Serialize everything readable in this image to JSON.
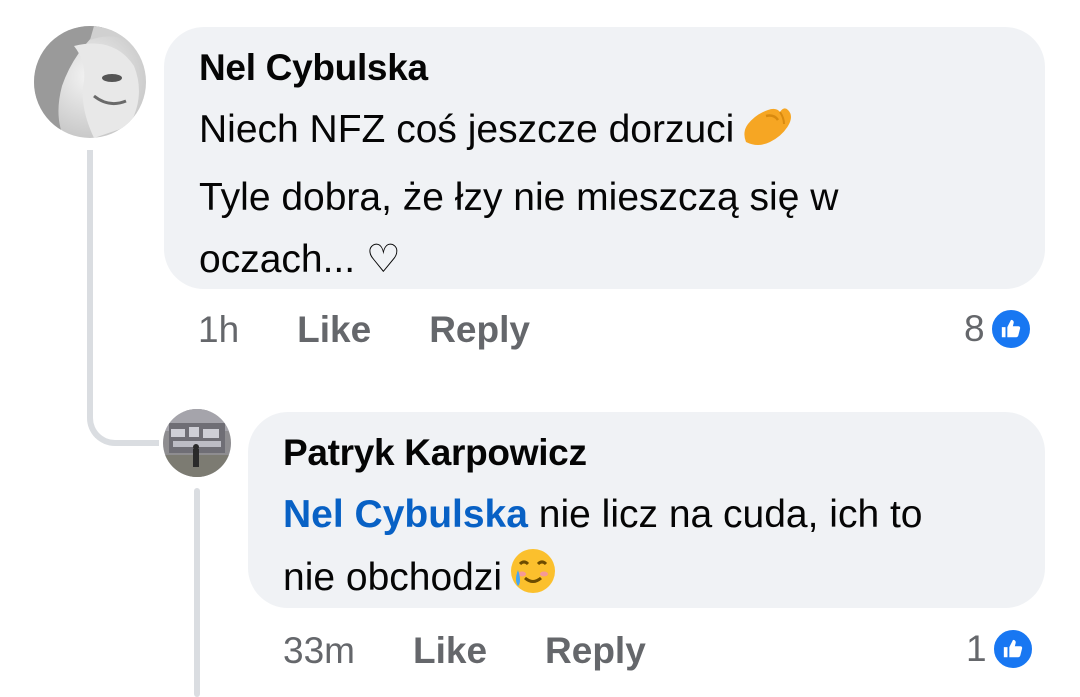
{
  "comments": [
    {
      "author": "Nel Cybulska",
      "lines": [
        "Niech NFZ coś jeszcze dorzuci",
        "Tyle dobra, że łzy nie mieszczą się w",
        "oczach... ♡"
      ],
      "emoji": "pinching-hand-emoji",
      "time": "1h",
      "like_label": "Like",
      "reply_label": "Reply",
      "reaction_count": "8"
    },
    {
      "author": "Patryk Karpowicz",
      "mention": "Nel Cybulska",
      "line1_rest": " nie licz na cuda, ich to",
      "line2": "nie obchodzi",
      "emoji": "smiling-face-with-tear-emoji",
      "time": "33m",
      "like_label": "Like",
      "reply_label": "Reply",
      "reaction_count": "1"
    }
  ],
  "colors": {
    "bubble": "#f0f2f5",
    "mention": "#0861c5",
    "meta": "#65676b",
    "like_badge": "#1877f2",
    "thread_line": "#dadde1"
  }
}
